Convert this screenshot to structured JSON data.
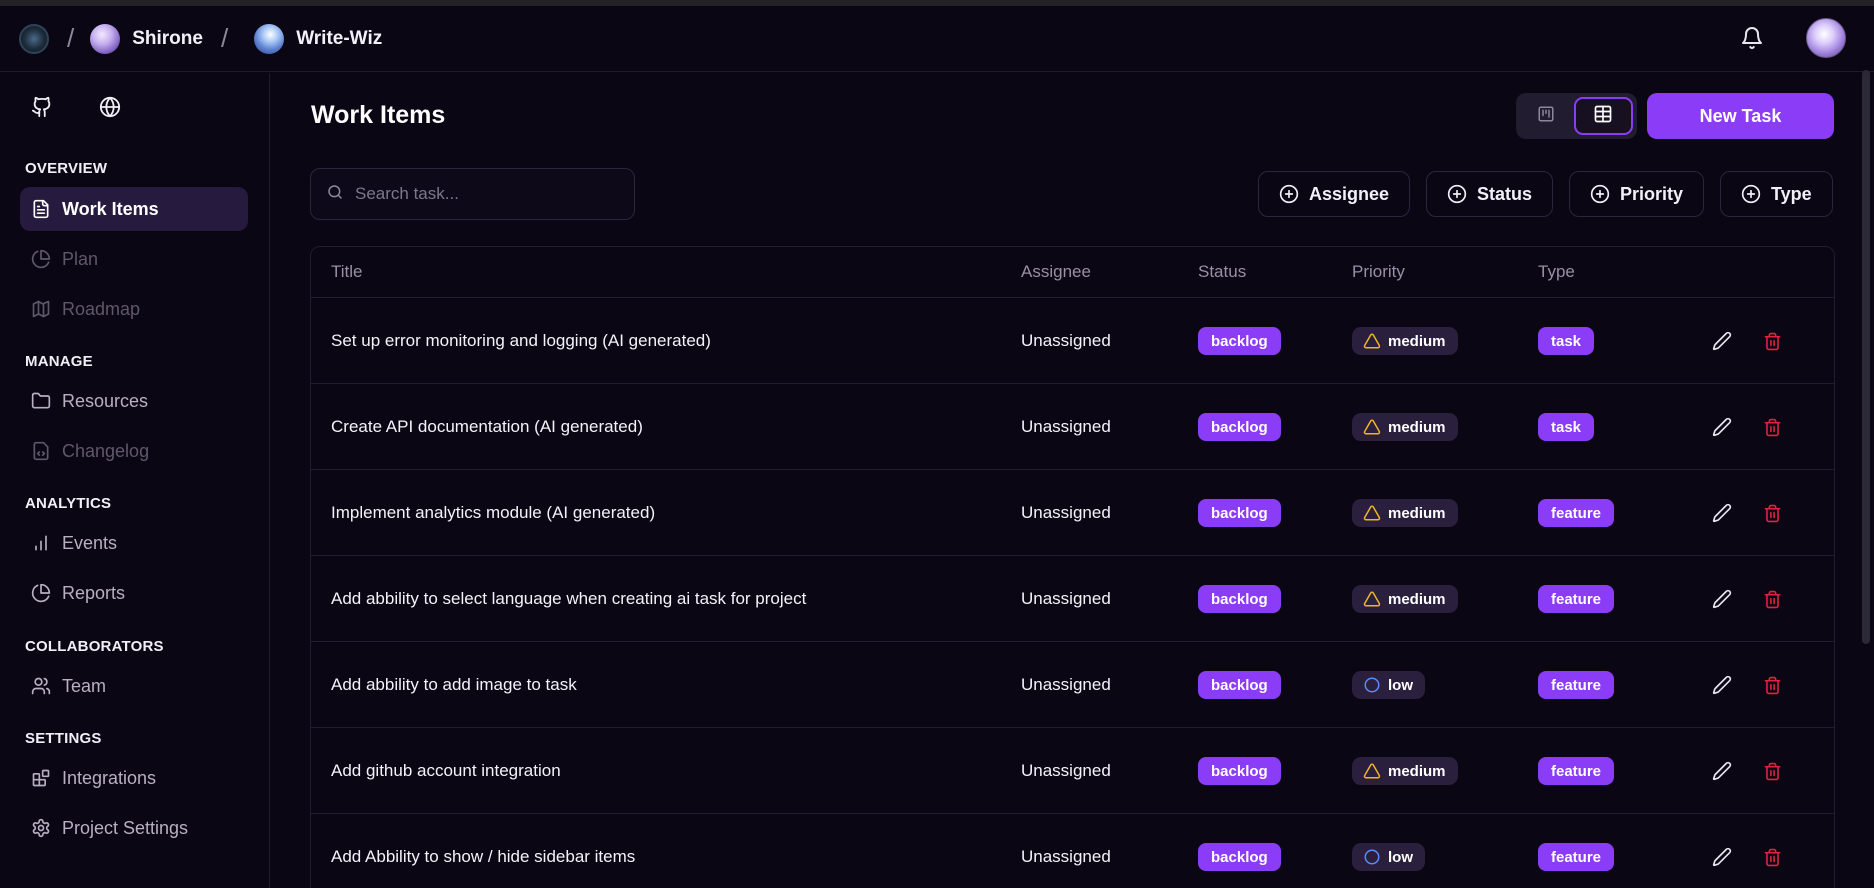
{
  "header": {
    "breadcrumbs": [
      {
        "label": "Shirone"
      },
      {
        "label": "Write-Wiz"
      }
    ],
    "separator": "/"
  },
  "sidebar": {
    "sections": [
      {
        "title": "OVERVIEW",
        "items": [
          {
            "label": "Work Items",
            "icon": "file-text-icon",
            "state": "active"
          },
          {
            "label": "Plan",
            "icon": "pie-chart-icon",
            "state": "disabled"
          },
          {
            "label": "Roadmap",
            "icon": "map-icon",
            "state": "disabled"
          }
        ]
      },
      {
        "title": "MANAGE",
        "items": [
          {
            "label": "Resources",
            "icon": "folder-icon",
            "state": "normal"
          },
          {
            "label": "Changelog",
            "icon": "file-code-icon",
            "state": "disabled"
          }
        ]
      },
      {
        "title": "ANALYTICS",
        "items": [
          {
            "label": "Events",
            "icon": "bar-chart-icon",
            "state": "normal"
          },
          {
            "label": "Reports",
            "icon": "pie-chart-icon",
            "state": "normal"
          }
        ]
      },
      {
        "title": "COLLABORATORS",
        "items": [
          {
            "label": "Team",
            "icon": "users-icon",
            "state": "normal"
          }
        ]
      },
      {
        "title": "SETTINGS",
        "items": [
          {
            "label": "Integrations",
            "icon": "blocks-icon",
            "state": "normal"
          },
          {
            "label": "Project Settings",
            "icon": "gear-icon",
            "state": "normal"
          }
        ]
      }
    ]
  },
  "main": {
    "title": "Work Items",
    "new_task_label": "New Task",
    "search_placeholder": "Search task...",
    "filters": [
      "Assignee",
      "Status",
      "Priority",
      "Type"
    ],
    "columns": [
      "Title",
      "Assignee",
      "Status",
      "Priority",
      "Type"
    ],
    "rows": [
      {
        "title": "Set up error monitoring and logging (AI generated)",
        "assignee": "Unassigned",
        "status": "backlog",
        "priority": "medium",
        "type": "task"
      },
      {
        "title": "Create API documentation (AI generated)",
        "assignee": "Unassigned",
        "status": "backlog",
        "priority": "medium",
        "type": "task"
      },
      {
        "title": "Implement analytics module (AI generated)",
        "assignee": "Unassigned",
        "status": "backlog",
        "priority": "medium",
        "type": "feature"
      },
      {
        "title": "Add abbility to select language when creating ai task for project",
        "assignee": "Unassigned",
        "status": "backlog",
        "priority": "medium",
        "type": "feature"
      },
      {
        "title": "Add abbility to add image to task",
        "assignee": "Unassigned",
        "status": "backlog",
        "priority": "low",
        "type": "feature"
      },
      {
        "title": "Add github account integration",
        "assignee": "Unassigned",
        "status": "backlog",
        "priority": "medium",
        "type": "feature"
      },
      {
        "title": "Add Abbility to show / hide sidebar items",
        "assignee": "Unassigned",
        "status": "backlog",
        "priority": "low",
        "type": "feature"
      }
    ]
  },
  "colors": {
    "accent": "#8b3cf7",
    "background": "#0b0614",
    "medium_icon": "#f0b429",
    "low_icon": "#5b8cff",
    "delete_icon": "#e0243f"
  }
}
